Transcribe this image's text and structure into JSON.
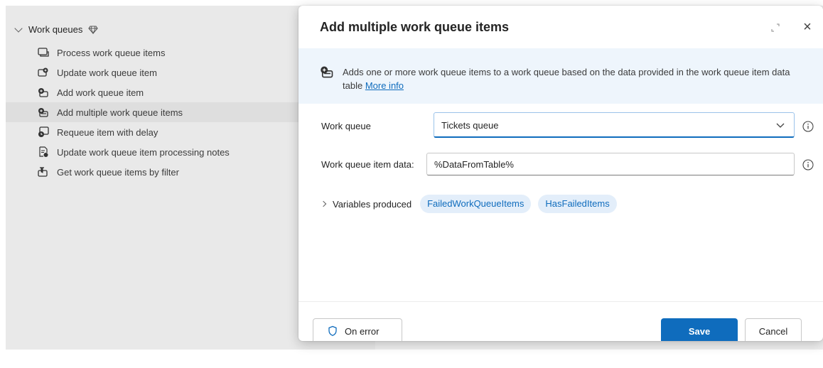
{
  "sidebar": {
    "group": {
      "label": "Work queues",
      "chevron_icon": "chevron-down-icon",
      "badge_icon": "premium-diamond-icon"
    },
    "items": [
      {
        "label": "Process work queue items",
        "icon": "process-queue-icon"
      },
      {
        "label": "Update work queue item",
        "icon": "update-queue-icon"
      },
      {
        "label": "Add work queue item",
        "icon": "add-queue-icon"
      },
      {
        "label": "Add multiple work queue items",
        "icon": "add-multiple-queue-icon",
        "selected": true
      },
      {
        "label": "Requeue item with delay",
        "icon": "requeue-icon"
      },
      {
        "label": "Update work queue item processing notes",
        "icon": "notes-icon"
      },
      {
        "label": "Get work queue items by filter",
        "icon": "filter-queue-icon"
      }
    ]
  },
  "dialog": {
    "title": "Add multiple work queue items",
    "expand_icon": "expand-icon",
    "close_icon": "close-icon",
    "close_glyph": "×",
    "description": "Adds one or more work queue items to a work queue based on the data provided in the work queue item data table",
    "more_info": "More info",
    "fields": {
      "work_queue": {
        "label": "Work queue",
        "value": "Tickets queue"
      },
      "item_data": {
        "label": "Work queue item data:",
        "value": "%DataFromTable%"
      }
    },
    "variables": {
      "label": "Variables produced",
      "items": [
        "FailedWorkQueueItems",
        "HasFailedItems"
      ]
    },
    "footer": {
      "on_error": "On error",
      "save": "Save",
      "cancel": "Cancel"
    }
  },
  "colors": {
    "accent": "#0f6cbd",
    "banner_bg": "#eef5fc",
    "chip_bg": "#e3eefa",
    "sidebar_bg": "#e9e9e9",
    "selected_bg": "#dedede"
  }
}
